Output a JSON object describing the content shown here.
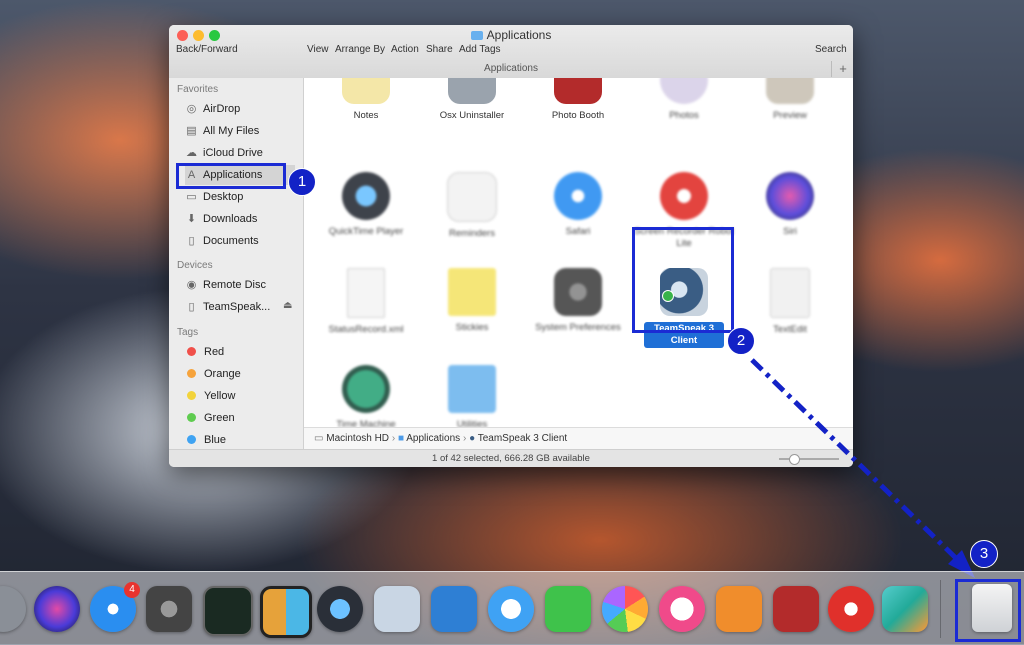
{
  "window": {
    "title": "Applications",
    "toolbar": {
      "back_forward": "Back/Forward",
      "view": "View",
      "arrange_by": "Arrange By",
      "action": "Action",
      "share": "Share",
      "add_tags": "Add Tags",
      "search": "Search"
    },
    "path_bar_label": "Applications",
    "add_tab": "+"
  },
  "sidebar": {
    "favorites_header": "Favorites",
    "favorites": [
      "AirDrop",
      "All My Files",
      "iCloud Drive",
      "Applications",
      "Desktop",
      "Downloads",
      "Documents"
    ],
    "devices_header": "Devices",
    "devices": [
      "Remote Disc",
      "TeamSpeak..."
    ],
    "tags_header": "Tags",
    "tags": [
      {
        "label": "Red",
        "color": "#f0504a"
      },
      {
        "label": "Orange",
        "color": "#f6a33c"
      },
      {
        "label": "Yellow",
        "color": "#f2d33b"
      },
      {
        "label": "Green",
        "color": "#5fcc50"
      },
      {
        "label": "Blue",
        "color": "#3fa3f2"
      }
    ]
  },
  "apps": {
    "row0": [
      "Notes",
      "Osx Uninstaller",
      "Photo Booth",
      "Photos",
      "Preview"
    ],
    "row1": [
      "QuickTime Player",
      "Reminders",
      "Safari",
      "Screen Recorder Robot Lite",
      "Siri"
    ],
    "row2": [
      "StatusRecord.xml",
      "Stickies",
      "System Preferences",
      "TeamSpeak 3 Client",
      "TextEdit"
    ],
    "row3": [
      "Time Machine",
      "Utilities"
    ]
  },
  "breadcrumb": [
    "Macintosh HD",
    "Applications",
    "TeamSpeak 3 Client"
  ],
  "status": "1 of 42 selected, 666.28 GB available",
  "annotations": [
    "1",
    "2",
    "3"
  ],
  "dock": {
    "badge_count": "4",
    "icons": [
      "launchpad-icon",
      "siri-icon",
      "app-store-icon",
      "system-preferences-icon",
      "activity-monitor-icon",
      "preview-icon",
      "quicktime-icon",
      "photo-icon",
      "xcode-icon",
      "messages-icon",
      "facetime-icon",
      "photos-icon",
      "itunes-icon",
      "ibooks-icon",
      "photo-booth-icon",
      "screen-recorder-icon",
      "screenshot-tool-icon",
      "trash-icon"
    ]
  },
  "colors": {
    "highlight": "#1b2bd4",
    "selection": "#1f6fd6"
  }
}
